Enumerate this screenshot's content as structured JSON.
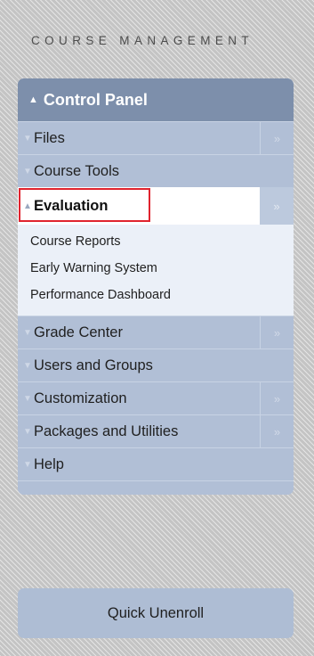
{
  "heading": "COURSE MANAGEMENT",
  "control_panel": {
    "title": "Control Panel",
    "items_before": [
      {
        "label": "Files",
        "has_arrow": true
      },
      {
        "label": "Course Tools",
        "has_arrow": false
      }
    ],
    "expanded": {
      "label": "Evaluation",
      "subitems": [
        "Course Reports",
        "Early Warning System",
        "Performance Dashboard"
      ]
    },
    "items_after": [
      {
        "label": "Grade Center",
        "has_arrow": true
      },
      {
        "label": "Users and Groups",
        "has_arrow": false
      },
      {
        "label": "Customization",
        "has_arrow": true
      },
      {
        "label": "Packages and Utilities",
        "has_arrow": true
      },
      {
        "label": "Help",
        "has_arrow": false
      }
    ]
  },
  "quick_unenroll": "Quick Unenroll",
  "colors": {
    "panel_header": "#7d8fab",
    "panel_row": "#b1bfd6",
    "highlight_border": "#e0232e"
  }
}
